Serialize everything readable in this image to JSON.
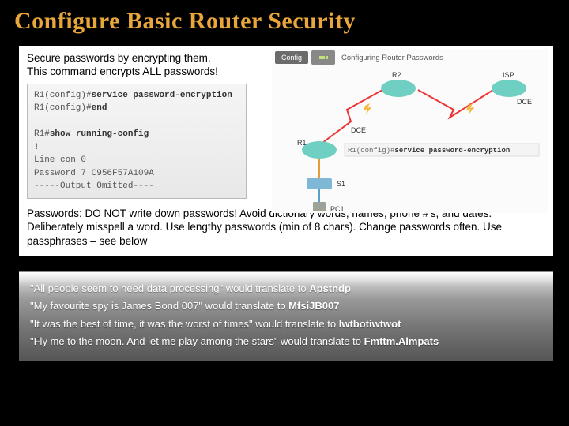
{
  "title": "Configure Basic Router Security",
  "intro": "Secure passwords by encrypting them. This command encrypts ALL passwords!",
  "cli": {
    "l1_prompt": "R1(config)#",
    "l1_cmd": "service password-encryption",
    "l2_prompt": "R1(config)#",
    "l2_cmd": "end",
    "l3_prompt": "R1#",
    "l3_cmd": "show running-config",
    "l4": "!",
    "l5": "Line con 0",
    "l6": "Password 7 C956F57A109A",
    "l7": "-----Output Omitted----"
  },
  "diagram": {
    "config_btn": "Config",
    "breadcrumb": "Configuring Router Passwords",
    "r1": "R1",
    "r2": "R2",
    "isp": "ISP",
    "s1": "S1",
    "pc1": "PC1",
    "dce1": "DCE",
    "dce2": "DCE",
    "cmd_prompt": "R1(config)#",
    "cmd_text": "service password-encryption"
  },
  "passwords_para": "Passwords: DO NOT write down passwords!  Avoid dictionary words, names, phone #'s, and dates.  Deliberately misspell a word.  Use lengthy passwords (min of 8 chars).  Change passwords often.  Use passphrases – see below",
  "phrases": {
    "p1a": "\"All people seem to need data processing\" would translate to ",
    "p1b": "Apstndp",
    "p2a": "\"My favourite spy is James Bond 007\" would translate to ",
    "p2b": "MfsiJB007",
    "p3a": "\"It was the best of time, it was the worst of times\" would translate to ",
    "p3b": "Iwtbotiwtwot",
    "p4a": "\"Fly me to the moon. And let me play among the stars\" would translate to ",
    "p4b": "Fmttm.Almpats"
  }
}
